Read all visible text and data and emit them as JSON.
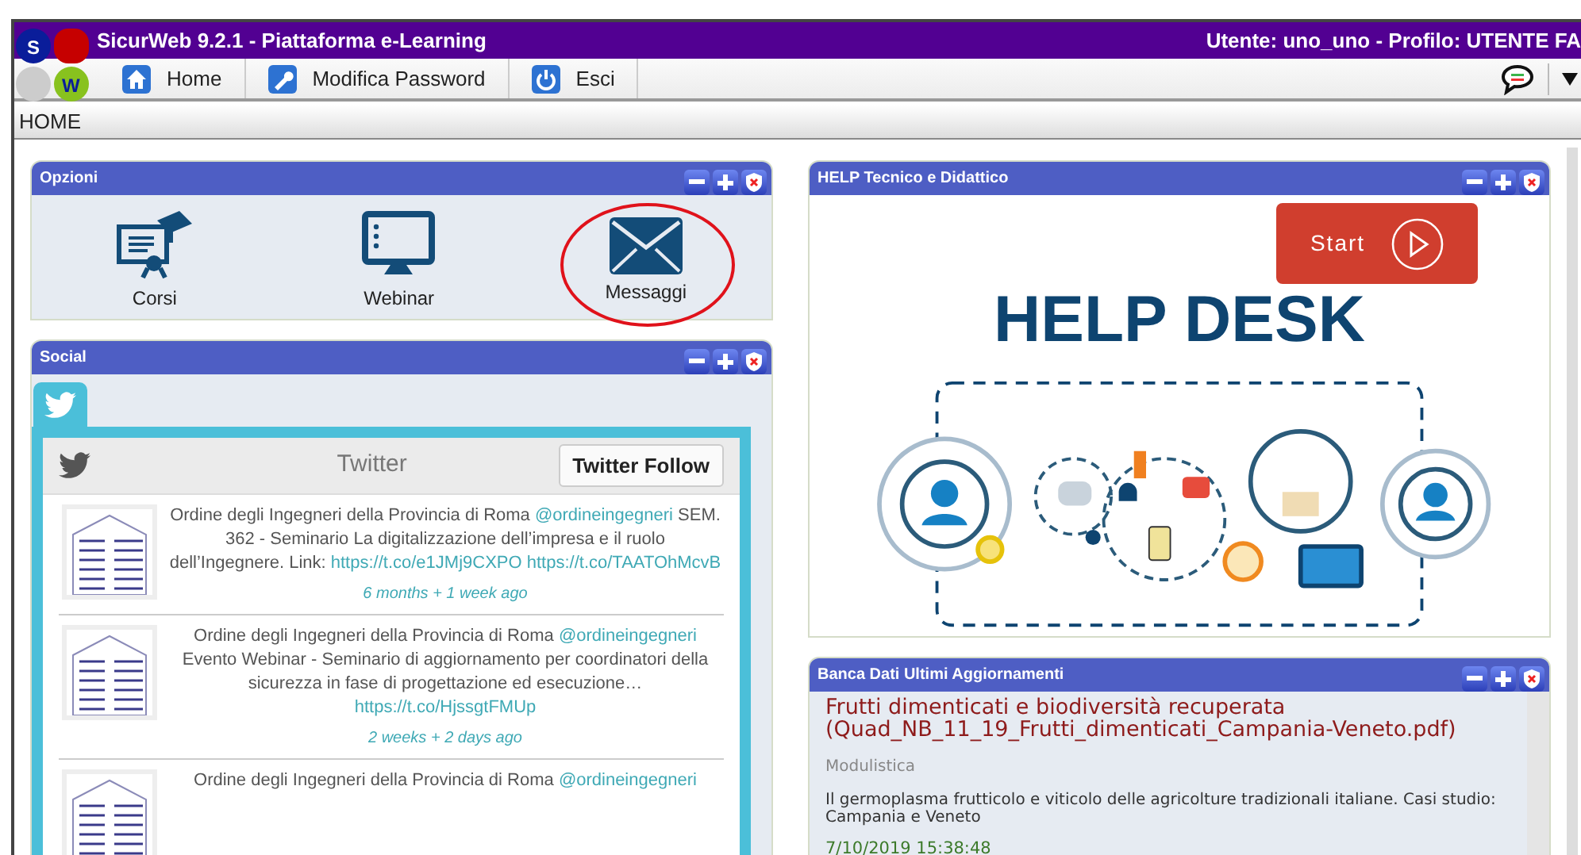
{
  "logo": {
    "letters": [
      "S",
      "W"
    ]
  },
  "app": {
    "title": "SicurWeb 9.2.1 - Piattaforma e-Learning",
    "user_info": "Utente: uno_uno - Profilo: UTENTE FA"
  },
  "menu": [
    {
      "label": "Home"
    },
    {
      "label": "Modifica Password"
    },
    {
      "label": "Esci"
    }
  ],
  "breadcrumb": "HOME",
  "options_panel": {
    "title": "Opzioni",
    "items": [
      {
        "label": "Corsi",
        "circled": false
      },
      {
        "label": "Webinar",
        "circled": false
      },
      {
        "label": "Messaggi",
        "circled": true
      }
    ]
  },
  "social_panel": {
    "title": "Social",
    "tabs": [
      {
        "selected": true
      }
    ],
    "feed_title": "Twitter",
    "follow_button": "Twitter Follow",
    "tweets": [
      {
        "author": "Ordine degli Ingegneri della Provincia di Roma",
        "handle": "@ordineingegneri",
        "text": "SEM. 362 - Seminario La digitalizzazione dell’impresa e il ruolo dell’Ingegnere. Link:",
        "links": [
          "https://t.co/e1JMj9CXPO",
          "https://t.co/TAATOhMcvB"
        ],
        "time": "6 months + 1 week ago"
      },
      {
        "author": "Ordine degli Ingegneri della Provincia di Roma",
        "handle": "@ordineingegneri",
        "text": "Evento Webinar - Seminario di aggiornamento per coordinatori della sicurezza in fase di progettazione ed esecuzione…",
        "links": [
          "https://t.co/HjssgtFMUp"
        ],
        "time": "2 weeks + 2 days ago"
      },
      {
        "author": "Ordine degli Ingegneri della Provincia di Roma",
        "handle": "@ordineingegneri"
      }
    ]
  },
  "help_panel": {
    "title": "HELP Tecnico e Didattico",
    "start_button": "Start",
    "banner_title": "HELP DESK"
  },
  "database_panel": {
    "title": "Banca Dati Ultimi Aggiornamenti",
    "entries": [
      {
        "title": "Frutti dimenticati e biodiversità recuperata (Quad_NB_11_19_Frutti_dimenticati_Campania-Veneto.pdf)",
        "category": "Modulistica",
        "description": "Il germoplasma frutticolo e viticolo delle agricolture tradizionali italiane. Casi studio: Campania e Veneto",
        "date": "7/10/2019 15:38:48"
      }
    ]
  }
}
